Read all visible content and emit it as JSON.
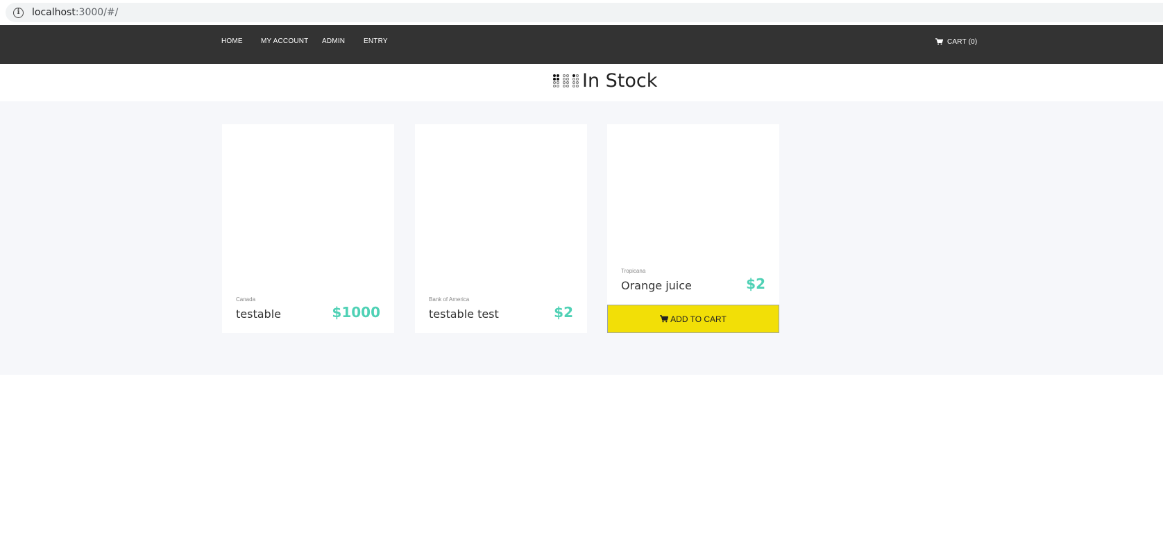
{
  "browser": {
    "url_host": "localhost",
    "url_path": ":3000/#/"
  },
  "nav": {
    "home": "HOME",
    "my_account": "MY ACCOUNT",
    "admin": "ADMIN",
    "entry": "ENTRY",
    "cart": "CART (0)"
  },
  "header": {
    "title": "In Stock"
  },
  "products": [
    {
      "brand": "Canada",
      "name": "testable",
      "price": "$1000"
    },
    {
      "brand": "Bank of America",
      "name": "testable test",
      "price": "$2"
    },
    {
      "brand": "Tropicana",
      "name": "Orange juice",
      "price": "$2",
      "button": "ADD TO CART"
    }
  ],
  "colors": {
    "navbar": "#333333",
    "price": "#4fd1b5",
    "add_to_cart": "#f2df07",
    "product_area_bg": "#f6f7fa"
  },
  "icons": [
    "info-icon",
    "cart-icon",
    "braille-icon"
  ]
}
